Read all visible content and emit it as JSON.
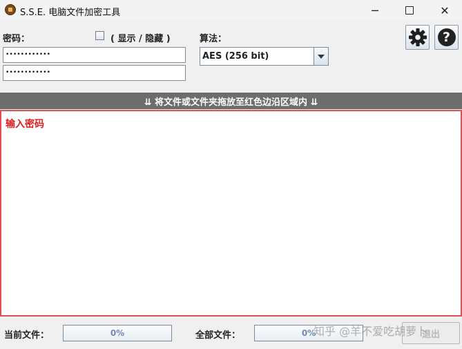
{
  "window": {
    "title": "S.S.E. 电脑文件加密工具",
    "minimize_label": "─",
    "close_label": "✕"
  },
  "password": {
    "label": "密码：",
    "field1_value": "••••••••••••",
    "field2_value": "••••••••••••",
    "show_hide_label": "( 显示 / 隐藏 )"
  },
  "algorithm": {
    "label": "算法：",
    "selected": "AES (256 bit)"
  },
  "toolbar": {
    "help_symbol": "?"
  },
  "dropzone": {
    "banner": "⇊ 将文件或文件夹拖放至红色边沿区域内 ⇊",
    "message": "输入密码"
  },
  "status": {
    "current_label": "当前文件：",
    "current_progress": "0%",
    "total_label": "全部文件：",
    "total_progress": "0%",
    "action_button": "退出"
  },
  "watermark": "知乎 @羊不爱吃胡萝卜"
}
